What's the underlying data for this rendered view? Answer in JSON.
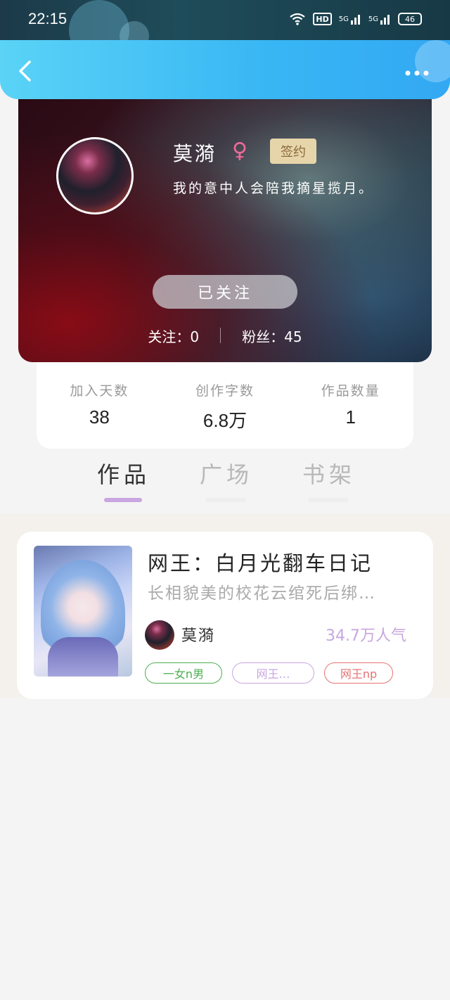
{
  "status_bar": {
    "time": "22:15",
    "hd": "HD",
    "signal1": "5G",
    "signal2": "5G",
    "battery": "46"
  },
  "profile": {
    "name": "莫漪",
    "gender_symbol": "♀",
    "badge": "签约",
    "bio": "我的意中人会陪我摘星揽月。",
    "follow_button": "已关注",
    "following_label": "关注：",
    "following_count": "0",
    "fans_label": "粉丝：",
    "fans_count": "45"
  },
  "stats": [
    {
      "label": "加入天数",
      "value": "38"
    },
    {
      "label": "创作字数",
      "value": "6.8万"
    },
    {
      "label": "作品数量",
      "value": "1"
    }
  ],
  "tabs": [
    {
      "label": "作品",
      "active": true
    },
    {
      "label": "广场",
      "active": false
    },
    {
      "label": "书架",
      "active": false
    }
  ],
  "works": [
    {
      "title": "网王：白月光翻车日记",
      "description": "长相貌美的校花云绾死后绑…",
      "author": "莫漪",
      "popularity": "34.7万人气",
      "tags": [
        "一女n男",
        "网王…",
        "网王np"
      ]
    }
  ],
  "colors": {
    "header": "#38b6f4",
    "accent": "#c8a6e0",
    "badge_bg": "#e6d5aa"
  }
}
